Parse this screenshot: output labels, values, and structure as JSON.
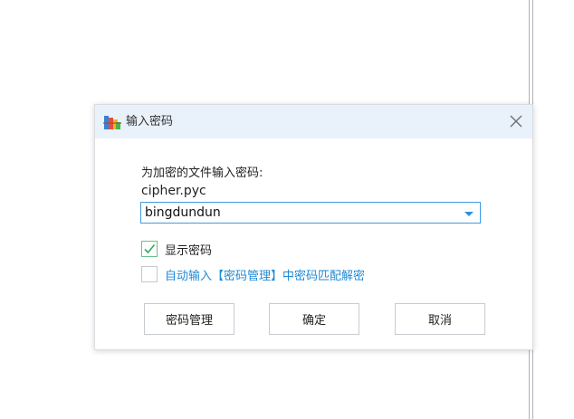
{
  "dialog": {
    "title": "输入密码",
    "prompt": "为加密的文件输入密码:",
    "filename": "cipher.pyc",
    "password_value": "bingdundun",
    "show_password": {
      "label": "显示密码",
      "checked": true
    },
    "auto_input": {
      "label": "自动输入【密码管理】中密码匹配解密",
      "checked": false
    },
    "buttons": {
      "manage": "密码管理",
      "ok": "确定",
      "cancel": "取消"
    }
  },
  "colors": {
    "titlebar_bg": "#e9f1fb",
    "accent_blue": "#2e8fde",
    "check_green": "#2fae5a",
    "link_blue": "#1f8ad6"
  },
  "icons": {
    "app": "winrar-books-icon",
    "close": "close-icon",
    "dropdown": "chevron-down-icon",
    "check": "checkmark-icon"
  }
}
